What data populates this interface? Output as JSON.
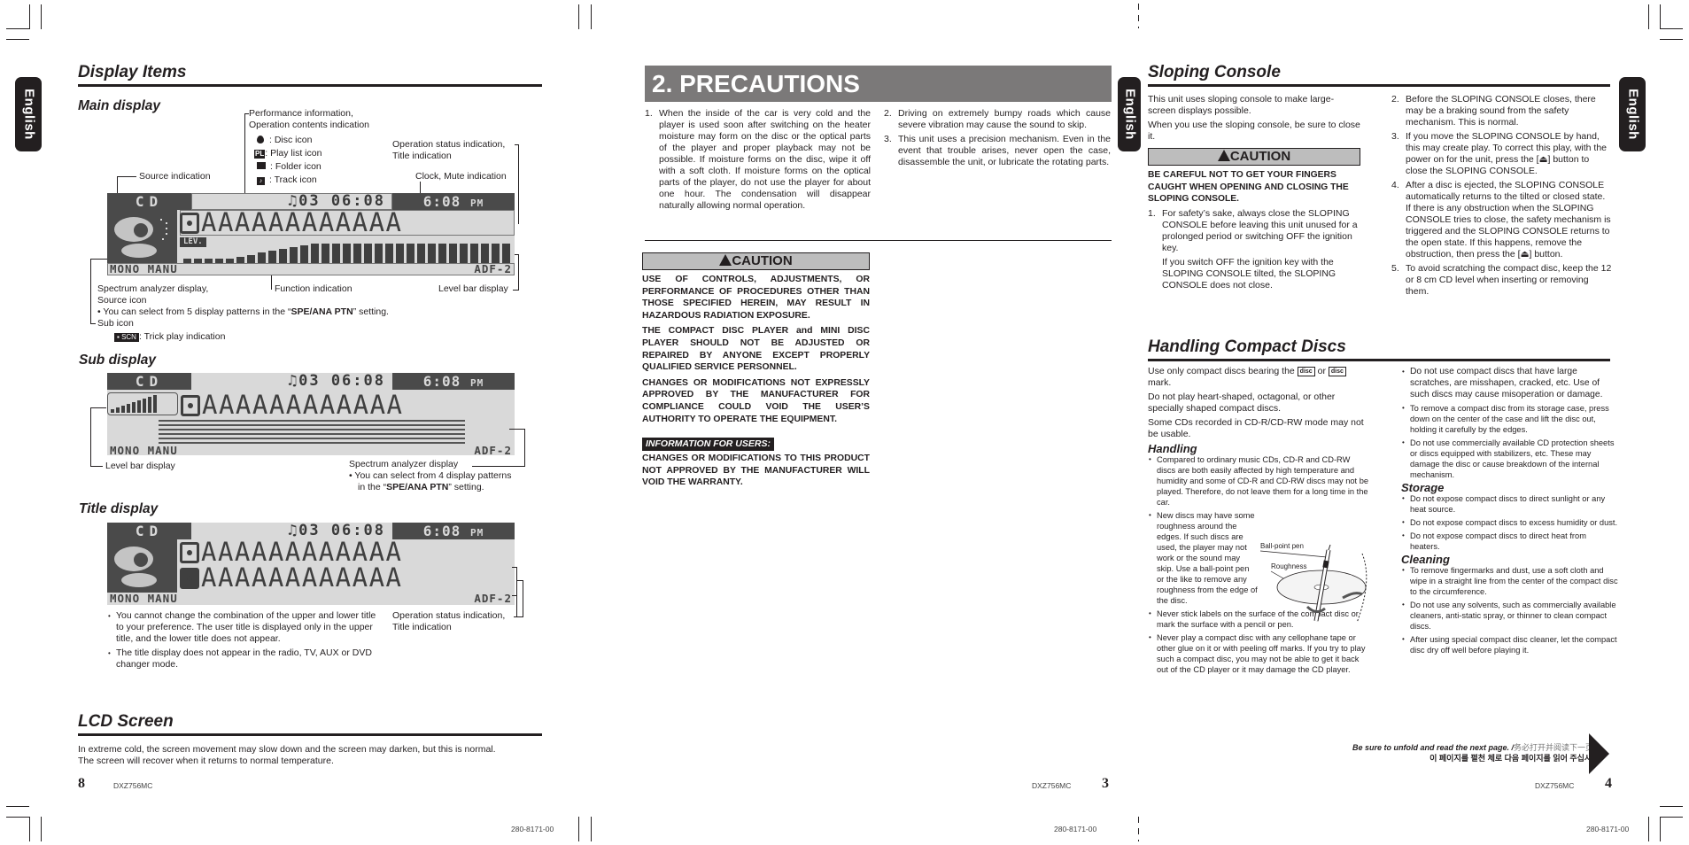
{
  "tab_label": "English",
  "left_page": {
    "title": "Display Items",
    "main_display": {
      "heading": "Main display",
      "lcd": {
        "source": "CD",
        "info": "♫03  06:08",
        "clock": "6:08",
        "ampm": "PM",
        "title_text": "AAAAAAAAAAAA",
        "level_label": "LEV.",
        "function_left": "MONO MANU",
        "function_right": "ADF-2"
      },
      "callouts": {
        "perf_info": "Performance information,",
        "perf_info2": "Operation contents indication",
        "disc_icon": ": Disc icon",
        "playlist_badge": "PL",
        "playlist_icon": ": Play list icon",
        "folder_icon": ": Folder icon",
        "track_icon": ": Track icon",
        "op_status": "Operation status indication,",
        "title_ind": "Title indication",
        "source_ind": "Source indication",
        "clock_mute": "Clock, Mute indication",
        "spectrum": "Spectrum analyzer display,",
        "source_icon": "Source icon",
        "patterns_note_pre": "You can select from 5 display patterns in the “",
        "patterns_note_bold": "SPE/ANA PTN",
        "patterns_note_post": "” setting.",
        "sub_icon": "Sub icon",
        "scn_badge": "SCN",
        "trick_play": ": Trick play indication",
        "function_ind": "Function indication",
        "level_bar": "Level bar display"
      }
    },
    "sub_display": {
      "heading": "Sub display",
      "level_bar": "Level bar display",
      "spectrum": "Spectrum analyzer display",
      "note_pre": "You can select from 4 display patterns in the “",
      "note_bold": "SPE/ANA PTN",
      "note_post": "” setting."
    },
    "title_display": {
      "heading": "Title display",
      "op_status": "Operation status indication,",
      "title_ind": "Title indication",
      "notes": [
        "You cannot change the combination of the upper and lower title to your preference. The user title is displayed only in the upper title, and the lower title does not appear.",
        "The title display does not appear in the radio, TV, AUX or DVD changer mode."
      ]
    },
    "lcd_screen": {
      "title": "LCD Screen",
      "line1": "In extreme cold, the screen movement may slow down and the screen may darken, but this is normal.",
      "line2": "The screen will recover when it returns to normal temperature."
    },
    "page_number": "8",
    "model": "DXZ756MC",
    "code": "280-8171-00"
  },
  "middle_page": {
    "title": "2. PRECAUTIONS",
    "items": [
      {
        "n": "1.",
        "text": "When the inside of the car is very cold and the player is used soon after switching on the heater moisture may form on the disc or the optical parts of the player and proper playback may not be possible. If moisture forms on the disc, wipe it off with a soft cloth. If moisture forms on the optical parts of the player, do not use the player for about one hour. The condensation will disappear naturally allowing normal operation."
      },
      {
        "n": "2.",
        "text": "Driving on extremely bumpy roads which cause severe vibration may cause the sound to skip."
      },
      {
        "n": "3.",
        "text": "This unit uses a precision mechanism. Even in the event that trouble arises, never open the case, disassemble the unit, or lubricate the rotating parts."
      }
    ],
    "caution_label": "CAUTION",
    "caution_paragraphs": [
      "USE OF CONTROLS, ADJUSTMENTS, OR PERFORMANCE OF PROCEDURES OTHER THAN THOSE SPECIFIED HEREIN, MAY RESULT IN HAZARDOUS RADIATION EXPOSURE.",
      "THE COMPACT DISC PLAYER and MINI DISC PLAYER SHOULD NOT BE ADJUSTED OR REPAIRED BY ANYONE EXCEPT PROPERLY QUALIFIED SERVICE PERSONNEL.",
      "CHANGES OR MODIFICATIONS NOT EXPRESSLY APPROVED BY THE MANUFACTURER FOR COMPLIANCE COULD VOID THE USER’S AUTHORITY TO OPERATE THE EQUIPMENT."
    ],
    "info_label": "INFORMATION FOR USERS:",
    "info_text": "CHANGES OR MODIFICATIONS TO THIS PRODUCT NOT APPROVED BY THE MANUFACTURER WILL VOID THE WARRANTY.",
    "page_number": "3",
    "model": "DXZ756MC",
    "code": "280-8171-00"
  },
  "right_page": {
    "sloping": {
      "title": "Sloping Console",
      "intro1": "This unit uses sloping console to make large-screen displays possible.",
      "intro2": "When you use the sloping console, be sure to close it.",
      "caution_label": "CAUTION",
      "caution_text": "BE CAREFUL NOT TO GET YOUR FINGERS CAUGHT WHEN OPENING AND CLOSING THE SLOPING CONSOLE.",
      "items": [
        {
          "n": "1.",
          "text": "For safety’s sake, always close the SLOPING CONSOLE before leaving this unit unused for a prolonged period or switching OFF the ignition key.",
          "sub": "If you switch OFF the ignition key with the SLOPING CONSOLE tilted, the SLOPING CONSOLE does not close."
        },
        {
          "n": "2.",
          "text": "Before the SLOPING CONSOLE closes, there may be a braking sound from the safety mechanism. This is normal."
        },
        {
          "n": "3.",
          "text": "If you move the SLOPING CONSOLE by hand, this may create play. To correct this play, with the power on for the unit, press the [⏏] button to close the SLOPING CONSOLE."
        },
        {
          "n": "4.",
          "text": "After a disc is ejected, the SLOPING CONSOLE automatically returns to the tilted or closed state. If there is any obstruction when the SLOPING CONSOLE tries to close, the safety mechanism is triggered and the SLOPING CONSOLE returns to the open state. If this happens, remove the obstruction, then press the [⏏] button."
        },
        {
          "n": "5.",
          "text": "To avoid scratching the compact disc, keep the 12 or 8 cm CD level when inserting or removing them."
        }
      ]
    },
    "handling": {
      "title": "Handling Compact Discs",
      "intro_pre": "Use only compact discs bearing the",
      "logo1": "disc",
      "intro_or": "or",
      "logo2": "disc",
      "intro_post": "mark.",
      "p2": "Do not play heart-shaped, octagonal, or other specially shaped compact discs.",
      "p3": "Some CDs recorded in CD-R/CD-RW mode may not be usable.",
      "handling_heading": "Handling",
      "handling_items": [
        "Compared to ordinary music CDs, CD-R and CD-RW discs are both easily affected by high temperature and humidity and some of CD-R and CD-RW discs may not be played. Therefore, do not leave them for a long time in the car.",
        "New discs may have some roughness around the edges. If such discs are used, the player may not work or the sound may skip. Use a ball-point pen or the like to remove any roughness from the edge of the disc.",
        "Never stick labels on the surface of the compact disc or mark the surface with a pencil or pen.",
        "Never play a compact disc with any cellophane tape or other glue on it or with peeling off marks. If you try to play such a compact disc, you may not be able to get it back out of the CD player or it may damage the CD player."
      ],
      "fig_ballpoint": "Ball-point pen",
      "fig_roughness": "Roughness",
      "right_items": [
        "Do not use compact discs that have large scratches, are misshapen, cracked, etc. Use of such discs may cause misoperation or damage.",
        "To remove a compact disc from its storage case, press down on the center of the case and lift the disc out, holding it carefully by the edges.",
        "Do not use commercially available CD protection sheets or discs equipped with stabilizers, etc. These may damage the disc or cause breakdown of the internal mechanism."
      ],
      "storage_heading": "Storage",
      "storage_items": [
        "Do not expose compact discs to direct sunlight or any heat source.",
        "Do not expose compact discs to excess humidity or dust.",
        "Do not expose compact discs to direct heat from heaters."
      ],
      "cleaning_heading": "Cleaning",
      "cleaning_items": [
        "To remove fingermarks and dust, use a soft cloth and wipe in a straight line from the center of the compact disc to the circumference.",
        "Do not use any solvents, such as commercially available cleaners, anti-static spray, or thinner to clean compact discs.",
        "After using special compact disc cleaner, let the compact disc dry off well before playing it."
      ]
    },
    "unfold_en": "Be sure to unfold and read the next page. /",
    "unfold_zh": "务必打开并阅读下一页。",
    "unfold_ko": "이 페이지를 펼천 체로 다음 페이지를 읽어 주십시오.",
    "page_number": "4",
    "model": "DXZ756MC",
    "code": "280-8171-00"
  }
}
